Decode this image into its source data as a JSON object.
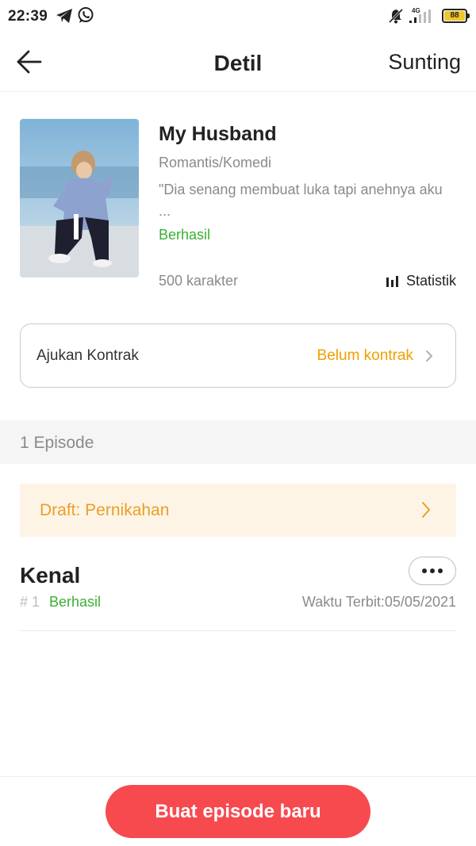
{
  "status_bar": {
    "time": "22:39",
    "icons": [
      "telegram-icon",
      "whatsapp-icon",
      "mute-icon",
      "signal-icon"
    ],
    "network": "4G",
    "battery": "88"
  },
  "nav": {
    "title": "Detil",
    "edit_label": "Sunting",
    "back_icon": "arrow-left-icon"
  },
  "book": {
    "title": "My Husband",
    "genre": "Romantis/Komedi",
    "description": "\"Dia senang membuat luka tapi anehnya aku  ...",
    "status": "Berhasil",
    "characters": "500 karakter",
    "stats_label": "Statistik",
    "stats_icon": "bar-chart-icon"
  },
  "contract": {
    "label": "Ajukan Kontrak",
    "value": "Belum kontrak"
  },
  "episodes": {
    "count_label": "1 Episode",
    "draft_label": "Draft: Pernikahan",
    "items": [
      {
        "title": "Kenal",
        "number": "# 1",
        "status": "Berhasil",
        "publish_time": "Waktu Terbit:05/05/2021"
      }
    ]
  },
  "actions": {
    "new_episode_label": "Buat episode baru"
  },
  "colors": {
    "accent_red": "#f74a4f",
    "success_green": "#3cb034",
    "warning_orange": "#f0a000",
    "draft_background": "#fef4e6"
  }
}
